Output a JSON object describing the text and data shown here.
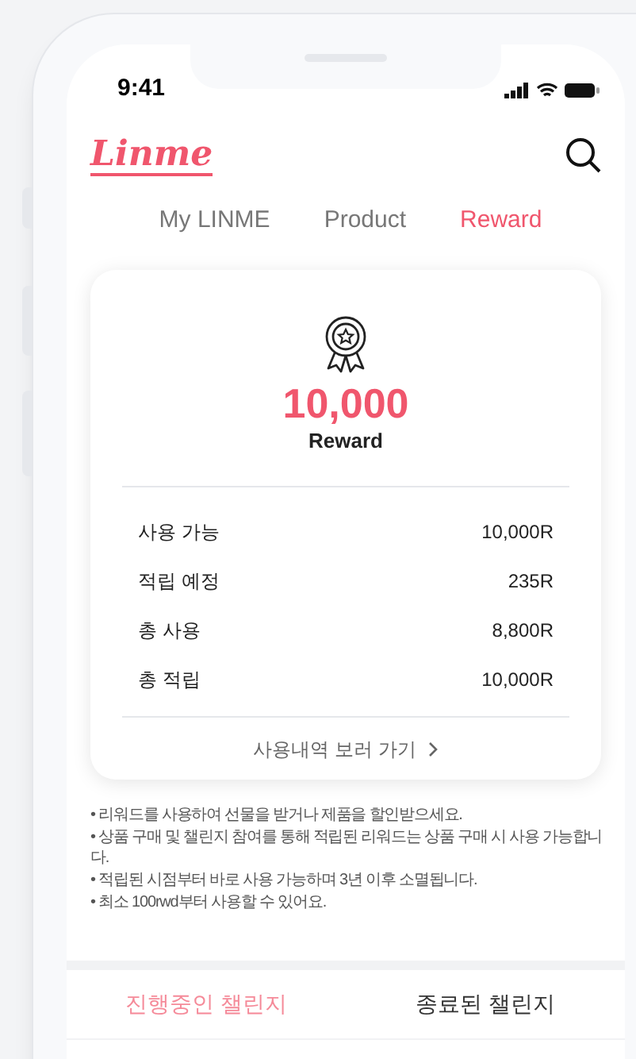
{
  "status_bar": {
    "time": "9:41"
  },
  "header": {
    "logo": "Linme"
  },
  "tabs": [
    {
      "label": "My LINME",
      "selected": false
    },
    {
      "label": "Product",
      "selected": false
    },
    {
      "label": "Reward",
      "selected": true
    }
  ],
  "reward_card": {
    "amount": "10,000",
    "unit": "Reward",
    "rows": [
      {
        "label": "사용 가능",
        "value": "10,000R"
      },
      {
        "label": "적립 예정",
        "value": "235R"
      },
      {
        "label": "총 사용",
        "value": "8,800R"
      },
      {
        "label": "총 적립",
        "value": "10,000R"
      }
    ],
    "link": "사용내역 보러 가기"
  },
  "notes": [
    "• 리워드를 사용하여 선물을 받거나 제품을 할인받으세요.",
    "• 상품 구매 및 챌린지 참여를 통해 적립된 리워드는 상품 구매 시 사용 가능합니다.",
    "• 적립된 시점부터 바로 사용 가능하며 3년 이후 소멸됩니다.",
    "• 최소 100rwd부터 사용할 수 있어요."
  ],
  "challenge_tabs": [
    {
      "label": "진행중인 챌린지",
      "selected": true
    },
    {
      "label": "종료된 챌린지",
      "selected": false
    }
  ]
}
